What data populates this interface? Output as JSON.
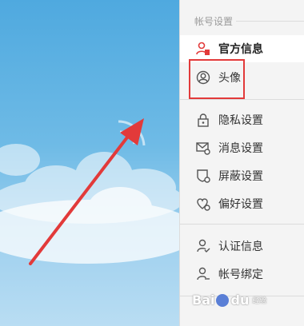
{
  "settings_panel": {
    "section_title": "帐号设置",
    "items": [
      {
        "label": "官方信息",
        "icon": "official-info-icon",
        "active": true
      },
      {
        "label": "头像",
        "icon": "avatar-icon",
        "active": false
      },
      {
        "label": "隐私设置",
        "icon": "lock-icon",
        "active": false
      },
      {
        "label": "消息设置",
        "icon": "message-settings-icon",
        "active": false
      },
      {
        "label": "屏蔽设置",
        "icon": "block-settings-icon",
        "active": false
      },
      {
        "label": "偏好设置",
        "icon": "heart-settings-icon",
        "active": false
      },
      {
        "label": "认证信息",
        "icon": "verify-icon",
        "active": false
      },
      {
        "label": "帐号绑定",
        "icon": "account-bind-icon",
        "active": false
      }
    ]
  },
  "watermark": {
    "text": "Bai",
    "text2": "du",
    "sub": "经验"
  },
  "colors": {
    "accent_red": "#e23a3a",
    "sky": "#6fbbe6"
  }
}
